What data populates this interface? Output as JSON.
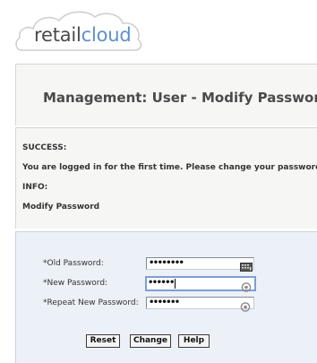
{
  "logo": {
    "retail": "retail",
    "cloud": "cloud"
  },
  "page": {
    "title": "Management: User - Modify Password"
  },
  "messages": {
    "success_heading": "SUCCESS:",
    "success_text": "You are logged in for the first time. Please change your password.",
    "info_heading": "INFO:",
    "info_text": "Modify Password"
  },
  "form": {
    "old_password": {
      "label": "*Old Password:",
      "value": "••••••••",
      "icon": "keyboard-icon"
    },
    "new_password": {
      "label": "*New Password:",
      "value": "••••••",
      "icon": "password-reveal-icon"
    },
    "repeat_password": {
      "label": "*Repeat New Password:",
      "value": "•••••••",
      "icon": "password-reveal-icon"
    }
  },
  "buttons": {
    "reset": "Reset",
    "change": "Change",
    "help": "Help"
  },
  "colors": {
    "logo_cloud_text": "#5f8fcf",
    "panel_background": "#f6f6f5",
    "form_background": "#ecf1f7",
    "focus_border": "#7e9ed6"
  }
}
